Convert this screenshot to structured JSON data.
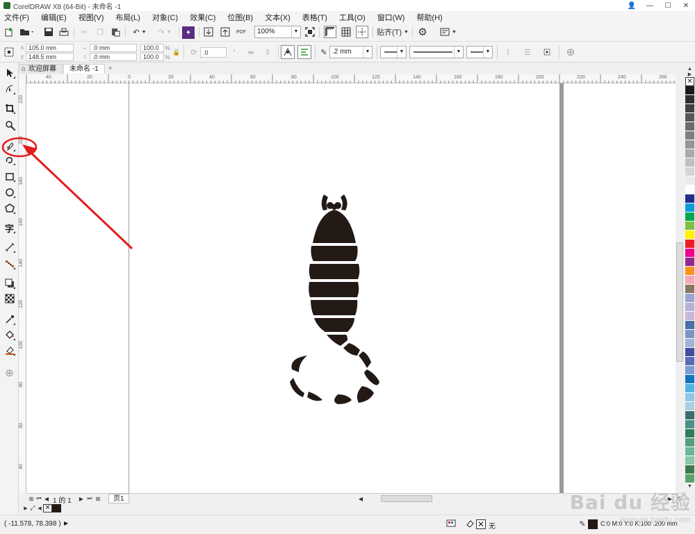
{
  "window": {
    "title": "CorelDRAW X8 (64-Bit) - 未命名 -1",
    "minimize": "—",
    "maximize": "☐",
    "close": "✕"
  },
  "menu": [
    "文件(F)",
    "编辑(E)",
    "视图(V)",
    "布局(L)",
    "对象(C)",
    "效果(C)",
    "位图(B)",
    "文本(X)",
    "表格(T)",
    "工具(O)",
    "窗口(W)",
    "帮助(H)"
  ],
  "toolbar": {
    "zoom": "100%",
    "snap_label": "贴齐(T)",
    "pdf_label": "PDF"
  },
  "property_bar": {
    "x": "105.0 mm",
    "y": "148.5 mm",
    "width": ".0 mm",
    "height": ".0 mm",
    "scale_x": "100.0",
    "scale_y": "100.0",
    "percent": "%",
    "rotation": ".0",
    "outline_width": ".2 mm"
  },
  "tabs": {
    "welcome": "欢迎屏幕",
    "doc": "未命名 -1",
    "add": "+"
  },
  "ruler_h": [
    "40",
    "20",
    "0",
    "20",
    "40",
    "60",
    "80",
    "100",
    "120",
    "140",
    "160",
    "180",
    "200",
    "220",
    "240",
    "260"
  ],
  "ruler_v": [
    "220",
    "200",
    "180",
    "160",
    "140",
    "120",
    "100",
    "80",
    "60",
    "40"
  ],
  "page_nav": {
    "of_label": "1 的 1",
    "page_tab": "页1"
  },
  "status": {
    "coords": "( -11.578, 78.398 )",
    "fill_label": "无",
    "outline_info": "C:0 M:0 Y:0 K:100  .200 mm"
  },
  "palette_colors": [
    "#1a1a1a",
    "#2d2d2d",
    "#404040",
    "#555555",
    "#6a6a6a",
    "#808080",
    "#959595",
    "#aaaaaa",
    "#c0c0c0",
    "#d5d5d5",
    "#eaeaea",
    "#ffffff",
    "#1f2f8a",
    "#0a9ed9",
    "#00a651",
    "#7cc242",
    "#fff200",
    "#ed1c24",
    "#ec008c",
    "#92278f",
    "#f7941d",
    "#f4a9b8",
    "#8a7560",
    "#9aa5d0",
    "#b7b0d8",
    "#c9b7d9",
    "#4a6fa5",
    "#7b96c6",
    "#9fb3d9",
    "#3f4fa0",
    "#5b6bb5",
    "#7b9dd0",
    "#0e76bc",
    "#52b4e2",
    "#8dc8e8",
    "#a9cfe0",
    "#3d6e6e",
    "#4b8f8b",
    "#2e7d5e",
    "#52a07d",
    "#6ab79a",
    "#8ac6a8",
    "#3c7a4e",
    "#5aa26a"
  ],
  "watermark": {
    "logo": "Bai du 经验",
    "url": "jingyan.baidu.com"
  }
}
